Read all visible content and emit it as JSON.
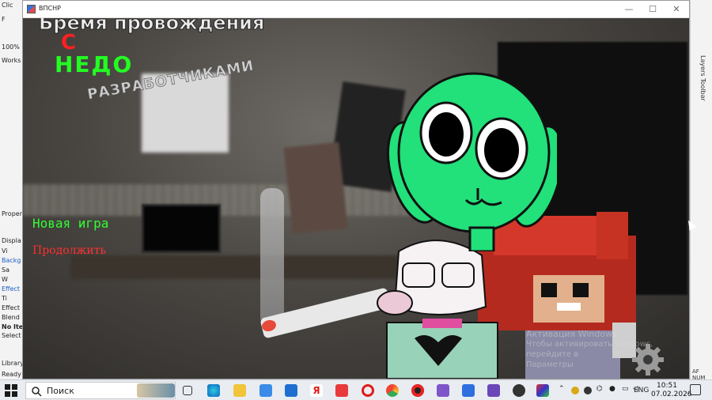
{
  "background_app": {
    "left_labels": [
      "Clic",
      "F",
      "100%",
      "Works",
      "Proper",
      "Displa",
      "Vi",
      "Backg",
      "Sa",
      "W",
      "Effect",
      "Ti",
      "Effect",
      "Blend",
      "No Ite",
      "Select",
      "Library",
      "Ready"
    ],
    "right_labels": [
      "Layers Toolbar"
    ],
    "status_right": "AF NUM"
  },
  "game_window": {
    "title": "ВПСНР",
    "controls": [
      "—",
      "☐",
      "✕"
    ]
  },
  "game": {
    "title_line1": "Бремя провождения",
    "title_line2": "С",
    "title_line3": "НЕДО",
    "title_line4": "РАЗРАБОТЧИКАМИ",
    "menu": {
      "new_game": "Новая игра",
      "continue": "Продолжить"
    },
    "watermark_line1": "Активация Windows",
    "watermark_line2": "Чтобы активировать Windows, перейдите в",
    "watermark_line3": "Параметры"
  },
  "taskbar": {
    "search_placeholder": "Поиск",
    "language": "ENG",
    "time": "10:51",
    "date": "07.02.2026",
    "pinned_icons": [
      "task-view-icon",
      "edge-icon",
      "folder-icon",
      "store-icon",
      "mail-icon",
      "yandex-icon",
      "wps-icon",
      "opera-icon",
      "chrome-icon",
      "record-icon",
      "app-icon",
      "bolt-icon",
      "app-icon-2",
      "obs-icon",
      "game-icon"
    ],
    "tray_icons": [
      "chevron-up-icon",
      "tray-app-icon",
      "tray-app-icon-2",
      "wifi-icon",
      "mic-icon",
      "network-icon",
      "volume-icon"
    ]
  },
  "colors": {
    "green_title": "#22ff22",
    "red_title": "#ff2020",
    "menu_green": "#33ff33",
    "menu_red": "#ff3030",
    "rabbit_green": "#22e07a"
  }
}
